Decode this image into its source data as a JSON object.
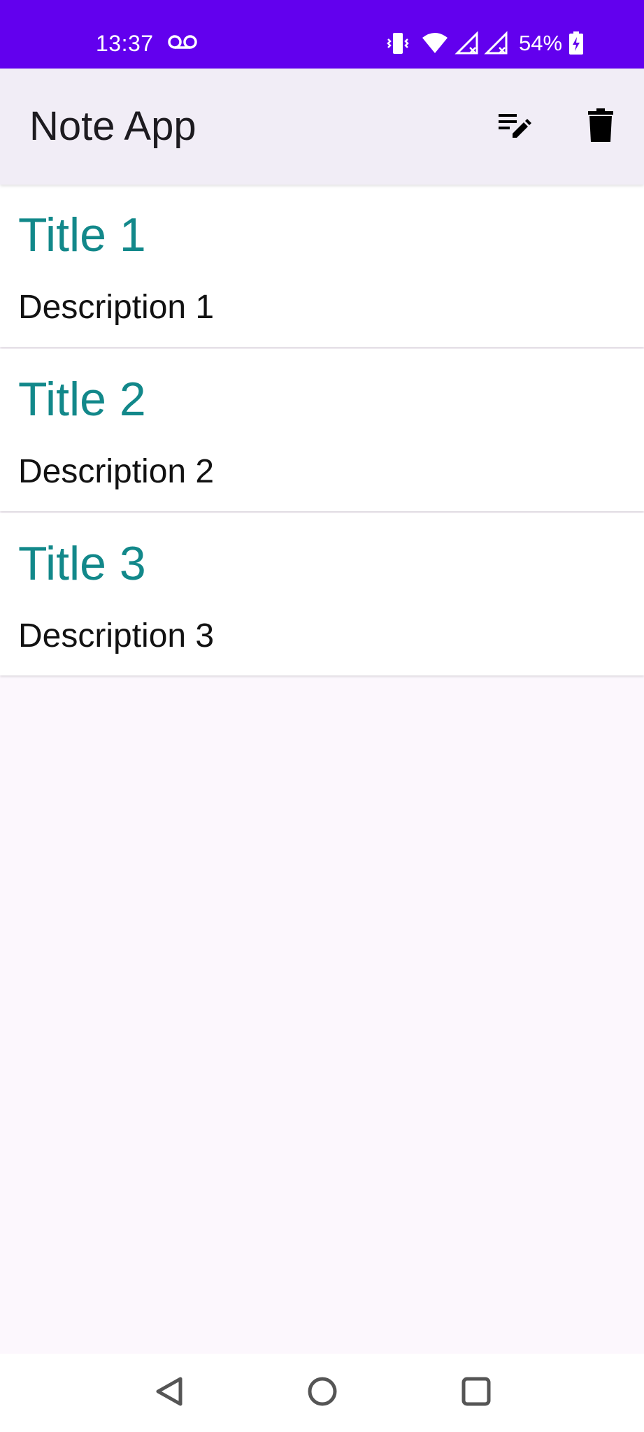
{
  "status_bar": {
    "time": "13:37",
    "battery_percent": "54%",
    "icons": [
      "voicemail-icon",
      "vibrate-icon",
      "wifi-icon",
      "signal-no-service-icon",
      "signal-no-service-icon",
      "battery-charging-icon"
    ],
    "background_color": "#6200ee"
  },
  "app_bar": {
    "title": "Note App",
    "actions": [
      "edit-list-icon",
      "delete-icon"
    ],
    "background_color": "#f1edf6"
  },
  "notes": [
    {
      "title": "Title 1",
      "description": "Description 1"
    },
    {
      "title": "Title 2",
      "description": "Description 2"
    },
    {
      "title": "Title 3",
      "description": "Description 3"
    }
  ],
  "colors": {
    "note_title": "#12888a",
    "note_description": "#121212",
    "page_background": "#fcf7fd"
  },
  "nav_bar": {
    "buttons": [
      "back-icon",
      "home-icon",
      "recents-icon"
    ]
  }
}
